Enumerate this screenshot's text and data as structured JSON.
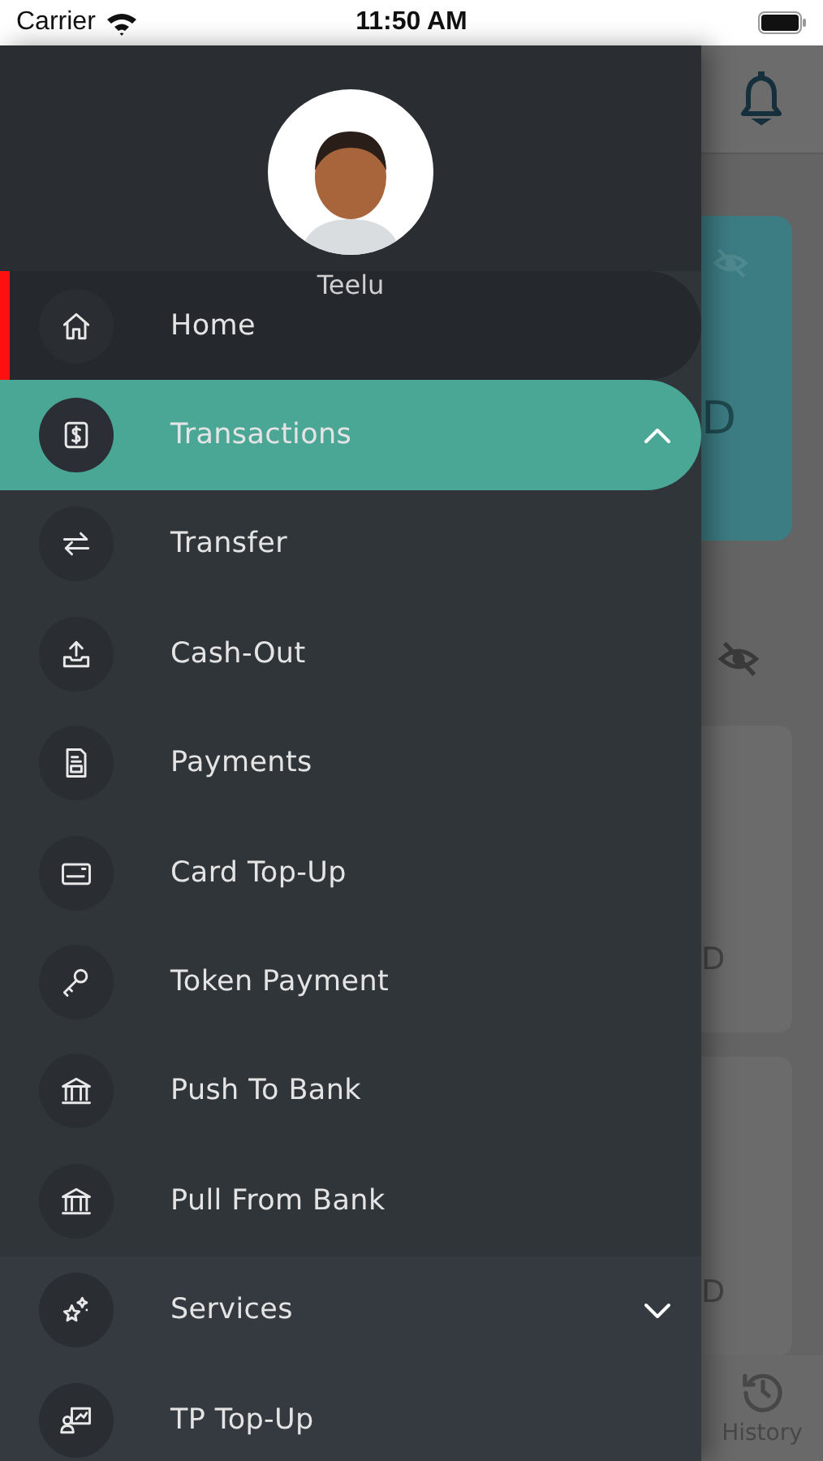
{
  "status_bar": {
    "carrier": "Carrier",
    "time": "11:50 AM"
  },
  "drawer": {
    "user_name": "Teelu",
    "items": [
      {
        "label": "Home",
        "selected": true
      },
      {
        "label": "Transactions",
        "selected": false,
        "expanded": true,
        "children": [
          {
            "label": "Transfer",
            "selected": false
          },
          {
            "label": "Cash-Out",
            "selected": false
          },
          {
            "label": "Payments",
            "selected": false
          },
          {
            "label": "Card Top-Up",
            "selected": false
          },
          {
            "label": "Token Payment",
            "selected": false
          },
          {
            "label": "Push To Bank",
            "selected": false
          },
          {
            "label": "Pull From Bank",
            "selected": false
          }
        ]
      },
      {
        "label": "Services",
        "selected": false,
        "expanded": false
      },
      {
        "label": "TP Top-Up",
        "selected": false
      }
    ]
  },
  "background": {
    "amount_texts": [
      "D",
      "D",
      "D"
    ],
    "nav_label": "History"
  }
}
